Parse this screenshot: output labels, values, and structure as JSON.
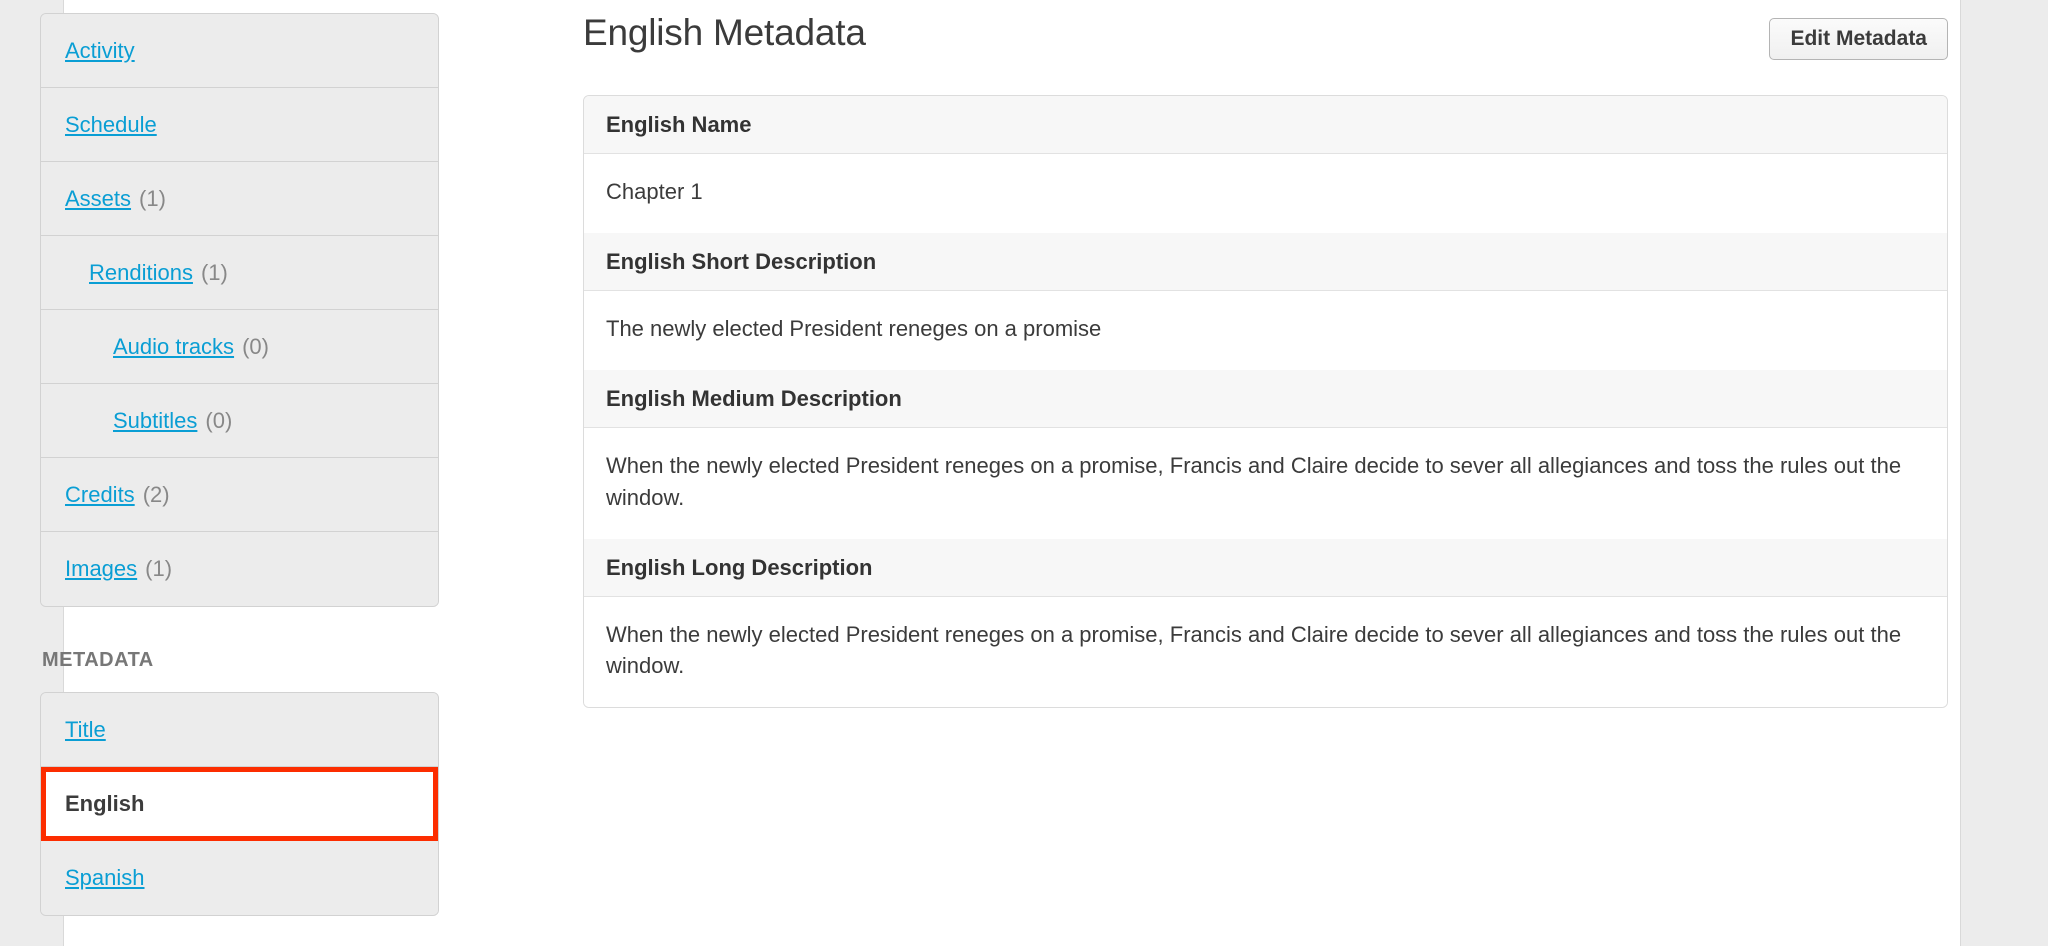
{
  "theme": {
    "link_color": "#0a9ed4",
    "highlight_color": "#fc2d00",
    "page_bg": "#ececec",
    "panel_bg": "#ececec",
    "label_row_bg": "#f7f7f7"
  },
  "sidebar": {
    "nav_items": [
      {
        "label": "Activity",
        "count": "",
        "indent": 0,
        "current": false
      },
      {
        "label": "Schedule",
        "count": "",
        "indent": 0,
        "current": false
      },
      {
        "label": "Assets",
        "count": "(1)",
        "indent": 0,
        "current": false
      },
      {
        "label": "Renditions",
        "count": "(1)",
        "indent": 1,
        "current": false
      },
      {
        "label": "Audio tracks",
        "count": "(0)",
        "indent": 2,
        "current": false
      },
      {
        "label": "Subtitles",
        "count": "(0)",
        "indent": 2,
        "current": false
      },
      {
        "label": "Credits",
        "count": "(2)",
        "indent": 0,
        "current": false
      },
      {
        "label": "Images",
        "count": "(1)",
        "indent": 0,
        "current": false
      }
    ],
    "metadata_heading": "METADATA",
    "metadata_items": [
      {
        "label": "Title",
        "count": "",
        "indent": 0,
        "current": false
      },
      {
        "label": "English",
        "count": "",
        "indent": 0,
        "current": true
      },
      {
        "label": "Spanish",
        "count": "",
        "indent": 0,
        "current": false
      }
    ]
  },
  "main": {
    "title": "English Metadata",
    "edit_button_label": "Edit Metadata",
    "fields": [
      {
        "label": "English Name",
        "value": "Chapter 1"
      },
      {
        "label": "English Short Description",
        "value": "The newly elected President reneges on a promise"
      },
      {
        "label": "English Medium Description",
        "value": "When the newly elected President reneges on a promise, Francis and Claire decide to sever all allegiances and toss the rules out the window."
      },
      {
        "label": "English Long Description",
        "value": "When the newly elected President reneges on a promise, Francis and Claire decide to sever all allegiances and toss the rules out the window."
      }
    ]
  }
}
